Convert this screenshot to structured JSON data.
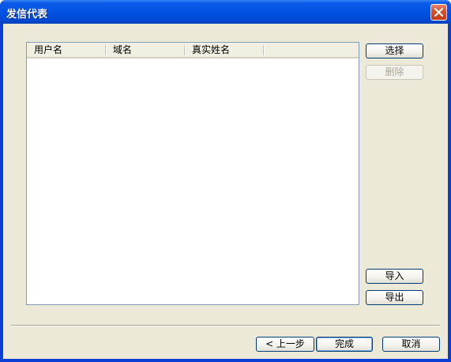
{
  "window": {
    "title": "发信代表"
  },
  "list": {
    "columns": [
      "用户名",
      "域名",
      "真实姓名"
    ],
    "rows": []
  },
  "side_buttons": {
    "select": "选择",
    "delete": "删除",
    "import": "导入",
    "export": "导出"
  },
  "footer_buttons": {
    "back": "< 上一步",
    "finish": "完成",
    "cancel": "取消"
  },
  "colors": {
    "titlebar": "#0354e3",
    "dialog_bg": "#ece9d8",
    "close_button": "#d8542e"
  }
}
